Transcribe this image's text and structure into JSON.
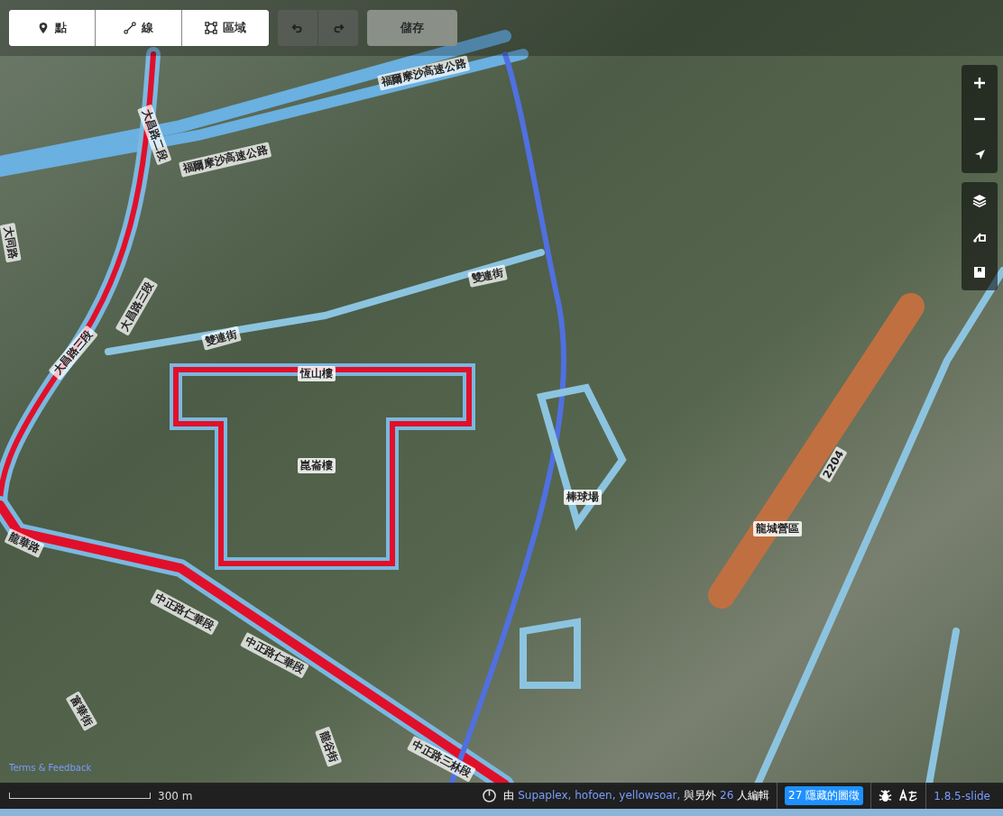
{
  "toolbar": {
    "modes": [
      {
        "kind": "point",
        "label": "點"
      },
      {
        "kind": "line",
        "label": "線"
      },
      {
        "kind": "area",
        "label": "區域"
      }
    ],
    "history": [
      {
        "kind": "undo",
        "disabled": true
      },
      {
        "kind": "redo",
        "disabled": true
      }
    ],
    "save": {
      "label": "儲存",
      "disabled": true
    }
  },
  "map_labels": [
    {
      "text": "福爾摩沙高速公路"
    },
    {
      "text": "福爾摩沙高速公路"
    },
    {
      "text": "大昌路二段"
    },
    {
      "text": "大同路"
    },
    {
      "text": "大昌路三段"
    },
    {
      "text": "大昌路三段"
    },
    {
      "text": "雙連街"
    },
    {
      "text": "雙連街"
    },
    {
      "text": "恆山樓"
    },
    {
      "text": "崑崙樓"
    },
    {
      "text": "棒球場"
    },
    {
      "text": "龍城營區"
    },
    {
      "text": "2204"
    },
    {
      "text": "龍華路"
    },
    {
      "text": "中正路仁華段"
    },
    {
      "text": "中正路仁華段"
    },
    {
      "text": "富華街"
    },
    {
      "text": "龍谷街"
    },
    {
      "text": "中正路三林段"
    }
  ],
  "map_controls": [
    {
      "kind": "zoom-in"
    },
    {
      "kind": "zoom-out"
    },
    {
      "kind": "locate"
    },
    {
      "kind": "layers"
    },
    {
      "kind": "map-data"
    },
    {
      "kind": "issues"
    }
  ],
  "footer": {
    "terms": "Terms & Feedback",
    "scale": "300 m",
    "attribution": {
      "prefix": "由",
      "users": "Supaplex, hofoen, yellowsoar,",
      "middle": "與另外",
      "count": "26",
      "suffix": "人編輯"
    },
    "hidden_features": "27 隱藏的圖徵",
    "version": "1.8.5-slide"
  }
}
